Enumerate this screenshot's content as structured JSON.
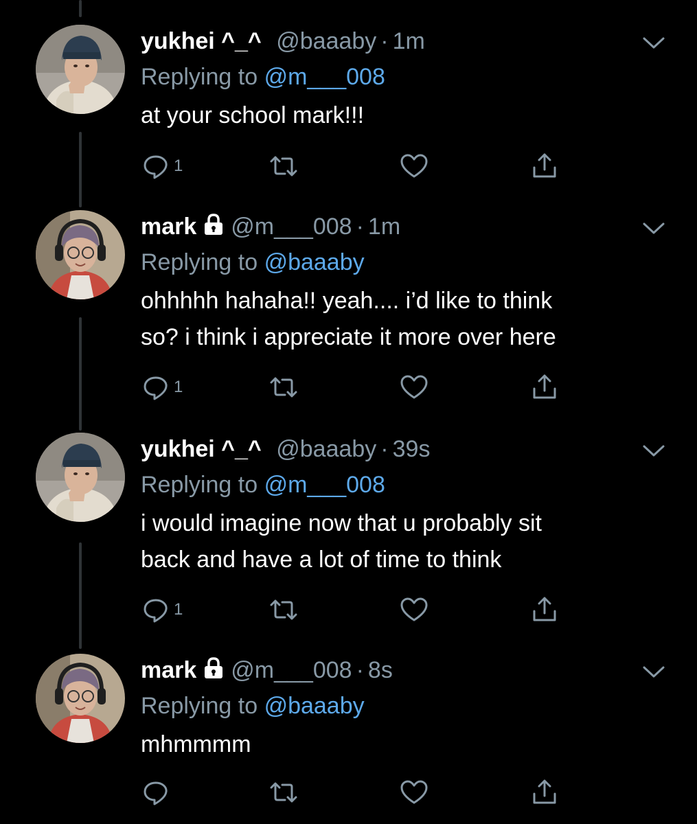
{
  "colors": {
    "background": "#000000",
    "text": "#ffffff",
    "muted": "#8899a6",
    "link": "#5da9ea",
    "thread_line": "#2f3336"
  },
  "icons": {
    "reply": "speech-bubble-icon",
    "retweet": "retweet-icon",
    "like": "heart-icon",
    "share": "share-icon",
    "menu": "chevron-down-icon",
    "protected": "lock-icon"
  },
  "tweets": [
    {
      "display_name": "yukhei ^_^",
      "protected": false,
      "handle": "@baaaby",
      "separator": "·",
      "time": "1m",
      "reply_prefix": "Replying to",
      "reply_to": "@m___008",
      "text_lines": [
        "at your school mark!!!"
      ],
      "reply_count": "1",
      "avatar": "yukhei-avatar"
    },
    {
      "display_name": "mark",
      "protected": true,
      "handle": "@m___008",
      "separator": "·",
      "time": "1m",
      "reply_prefix": "Replying to",
      "reply_to": "@baaaby",
      "text_lines": [
        "ohhhhh hahaha!! yeah.... i’d like to think",
        "so? i think i appreciate it more over here"
      ],
      "reply_count": "1",
      "avatar": "mark-avatar"
    },
    {
      "display_name": "yukhei ^_^",
      "protected": false,
      "handle": "@baaaby",
      "separator": "·",
      "time": "39s",
      "reply_prefix": "Replying to",
      "reply_to": "@m___008",
      "text_lines": [
        "i would imagine now that u probably sit",
        "back and have a lot of time to think"
      ],
      "reply_count": "1",
      "avatar": "yukhei-avatar"
    },
    {
      "display_name": "mark",
      "protected": true,
      "handle": "@m___008",
      "separator": "·",
      "time": "8s",
      "reply_prefix": "Replying to",
      "reply_to": "@baaaby",
      "text_lines": [
        "mhmmmm"
      ],
      "reply_count": "",
      "avatar": "mark-avatar"
    }
  ]
}
